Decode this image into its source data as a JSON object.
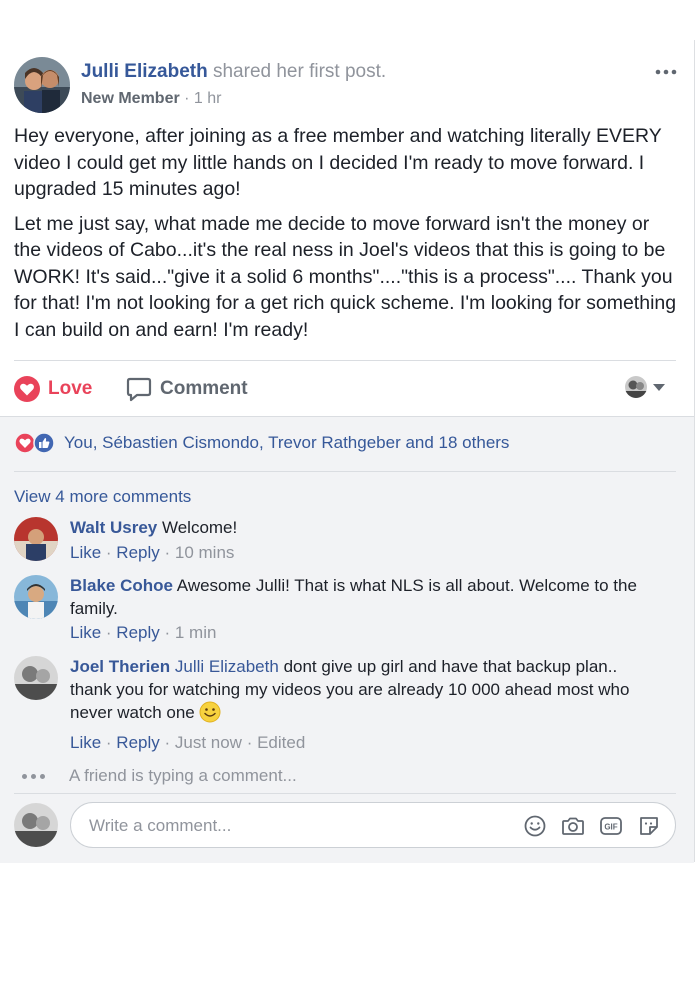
{
  "post": {
    "author": "Julli Elizabeth",
    "action": "shared her first post.",
    "badge": "New Member",
    "separator": " · ",
    "time": "1 hr",
    "paragraphs": [
      "Hey everyone, after joining as a free member and watching literally EVERY video I could get my little hands on I decided I'm ready to move forward. I upgraded 15 minutes ago!",
      "Let me just say, what made me decide to move forward isn't the money or the videos of Cabo...it's the real ness in Joel's videos that this is going to be WORK! It's said...\"give it a solid 6 months\"....\"this is a process\".... Thank you for that! I'm not looking for a get rich quick scheme. I'm looking for something I can build on and earn! I'm ready!"
    ]
  },
  "actions": {
    "love_label": "Love",
    "comment_label": "Comment"
  },
  "reactions": {
    "names": "You, Sébastien Cismondo, Trevor Rathgeber and 18 others"
  },
  "comments_section": {
    "view_more": "View 4 more comments",
    "like_label": "Like",
    "reply_label": "Reply",
    "dot": " · ",
    "comments": [
      {
        "author": "Walt Usrey",
        "text": "Welcome!",
        "time": "10 mins"
      },
      {
        "author": "Blake Cohoe",
        "text": "Awesome Julli! That is what NLS is all about. Welcome to the family.",
        "time": "1 min"
      },
      {
        "author": "Joel Therien",
        "mention": "Julli Elizabeth",
        "text": "dont give up girl and have that backup plan.. thank you for watching my videos you are already 10 000 ahead most who never watch one",
        "time": "Just now",
        "edited": "Edited"
      }
    ],
    "typing": "A friend is typing a comment...",
    "composer_placeholder": "Write a comment..."
  },
  "colors": {
    "link": "#365899",
    "love": "#e9435a",
    "muted": "#90949c",
    "like_blue": "#4267b2"
  },
  "icons": [
    "more-options-icon",
    "heart-icon",
    "comment-bubble-icon",
    "emoji-icon",
    "camera-icon",
    "gif-icon",
    "sticker-icon"
  ]
}
